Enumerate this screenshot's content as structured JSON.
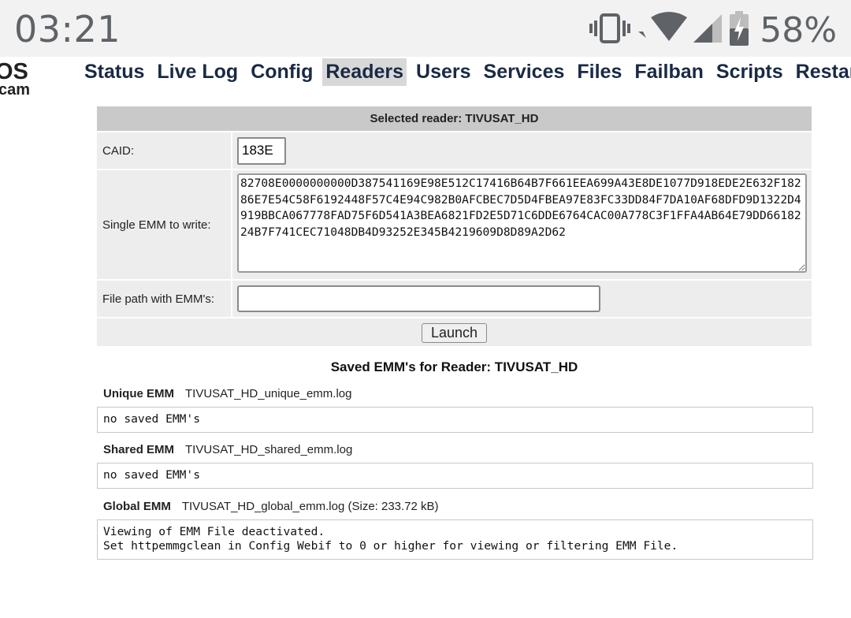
{
  "status_bar": {
    "time": "03:21",
    "battery_percent": "58%",
    "icons": [
      "vibrate-icon",
      "wifi-icon",
      "cell-signal-icon",
      "battery-charging-icon"
    ]
  },
  "nav": {
    "items": [
      "Status",
      "Live Log",
      "Config",
      "Readers",
      "Users",
      "Services",
      "Files",
      "Failban",
      "Scripts",
      "Restart"
    ],
    "active": "Readers"
  },
  "form": {
    "header": "Selected reader: TIVUSAT_HD",
    "caid_label": "CAID:",
    "caid_value": "183E",
    "emm_label": "Single EMM to write:",
    "emm_value": "82708E0000000000D387541169E98E512C17416B64B7F661EEA699A43E8DE1077D918EDE2E632F18286E7E54C58F6192448F57C4E94C982B0AFCBEC7D5D4FBEA97E83FC33DD84F7DA10AF68DFD9D1322D4919BBCA067778FAD75F6D541A3BEA6821FD2E5D71C6DDE6764CAC00A778C3F1FFA4AB64E79DD6618224B7F741CEC71048DB4D93252E345B4219609D8D89A2D62",
    "file_label": "File path with EMM's:",
    "file_value": "",
    "launch_label": "Launch"
  },
  "saved": {
    "title": "Saved EMM's for Reader: TIVUSAT_HD",
    "unique": {
      "kind": "Unique EMM",
      "file": "TIVUSAT_HD_unique_emm.log",
      "content": "no saved EMM's"
    },
    "shared": {
      "kind": "Shared EMM",
      "file": "TIVUSAT_HD_shared_emm.log",
      "content": "no saved EMM's"
    },
    "global": {
      "kind": "Global EMM",
      "file": "TIVUSAT_HD_global_emm.log (Size: 233.72 kB)",
      "content": "Viewing of EMM File deactivated.\nSet httpemmgclean in Config Webif to 0 or higher for viewing or filtering EMM File."
    }
  },
  "colors": {
    "nav_text": "#1a2a44",
    "nav_active_bg": "#d8d8d8",
    "table_header_bg": "#c9c9c9",
    "table_row_bg": "#ededed",
    "statusbar_text": "#5f6368"
  }
}
